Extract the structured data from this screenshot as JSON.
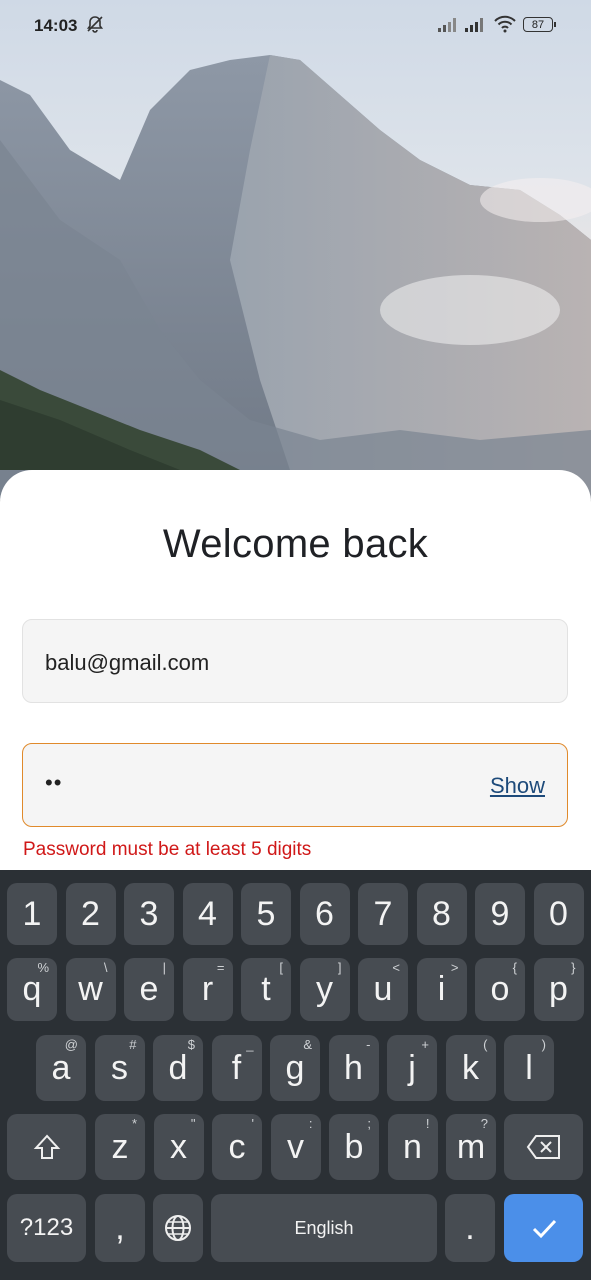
{
  "status_bar": {
    "time": "14:03",
    "battery": "87",
    "icons": [
      "mute-bell-icon",
      "signal-icon",
      "signal-icon",
      "wifi-icon",
      "battery-icon"
    ]
  },
  "login": {
    "title": "Welcome back",
    "email_value": "balu@gmail.com",
    "password_mask": "••",
    "show_label": "Show",
    "error_text": "Password must be at least 5 digits",
    "colors": {
      "error": "#d01818",
      "focus_border": "#e08a2b",
      "link": "#1d4a7a"
    }
  },
  "keyboard": {
    "row1": [
      {
        "k": "1"
      },
      {
        "k": "2"
      },
      {
        "k": "3"
      },
      {
        "k": "4"
      },
      {
        "k": "5"
      },
      {
        "k": "6"
      },
      {
        "k": "7"
      },
      {
        "k": "8"
      },
      {
        "k": "9"
      },
      {
        "k": "0"
      }
    ],
    "row2": [
      {
        "k": "q",
        "h": "%"
      },
      {
        "k": "w",
        "h": "\\"
      },
      {
        "k": "e",
        "h": "|"
      },
      {
        "k": "r",
        "h": "="
      },
      {
        "k": "t",
        "h": "["
      },
      {
        "k": "y",
        "h": "]"
      },
      {
        "k": "u",
        "h": "<"
      },
      {
        "k": "i",
        "h": ">"
      },
      {
        "k": "o",
        "h": "{"
      },
      {
        "k": "p",
        "h": "}"
      }
    ],
    "row3": [
      {
        "k": "a",
        "h": "@"
      },
      {
        "k": "s",
        "h": "#"
      },
      {
        "k": "d",
        "h": "$"
      },
      {
        "k": "f",
        "h": "_"
      },
      {
        "k": "g",
        "h": "&"
      },
      {
        "k": "h",
        "h": "-"
      },
      {
        "k": "j",
        "h": "+"
      },
      {
        "k": "k",
        "h": "("
      },
      {
        "k": "l",
        "h": ")"
      }
    ],
    "row4": [
      {
        "k": "z",
        "h": "*"
      },
      {
        "k": "x",
        "h": "\""
      },
      {
        "k": "c",
        "h": "'"
      },
      {
        "k": "v",
        "h": ":"
      },
      {
        "k": "b",
        "h": ";"
      },
      {
        "k": "n",
        "h": "!"
      },
      {
        "k": "m",
        "h": "?"
      }
    ],
    "symbols_label": "?123",
    "comma": ",",
    "space_label": "English",
    "period": ".",
    "accent": "#4b8fe9"
  }
}
